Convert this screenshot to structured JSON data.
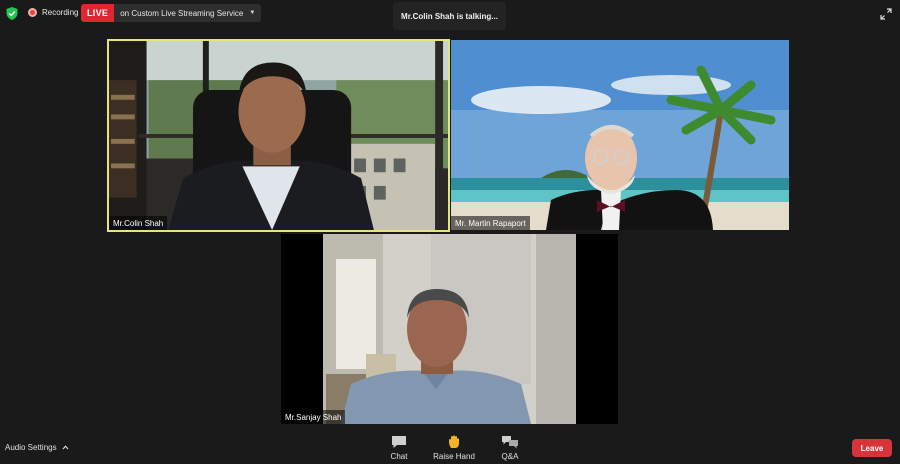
{
  "topbar": {
    "recording_label": "Recording",
    "live_label": "LIVE",
    "live_service": "on Custom Live Streaming Service",
    "talking_banner": "Mr.Colin Shah is talking..."
  },
  "participants": [
    {
      "name": "Mr.Colin Shah",
      "active_speaker": true
    },
    {
      "name": "Mr. Martin Rapaport",
      "active_speaker": false
    },
    {
      "name": "Mr.Sanjay Shah",
      "active_speaker": false
    }
  ],
  "toolbar": {
    "audio_settings": "Audio Settings",
    "chat": "Chat",
    "raise_hand": "Raise Hand",
    "qa": "Q&A",
    "leave": "Leave"
  },
  "colors": {
    "background": "#1a1a1a",
    "active_speaker_border": "#e3e67a",
    "live_red": "#e0262f",
    "leave_red": "#d6333a",
    "shield_green": "#23c552"
  },
  "icons": [
    "shield-icon",
    "recording-dot-icon",
    "caret-down-icon",
    "fullscreen-icon",
    "chevron-up-icon",
    "chat-icon",
    "raise-hand-icon",
    "qa-icon"
  ]
}
